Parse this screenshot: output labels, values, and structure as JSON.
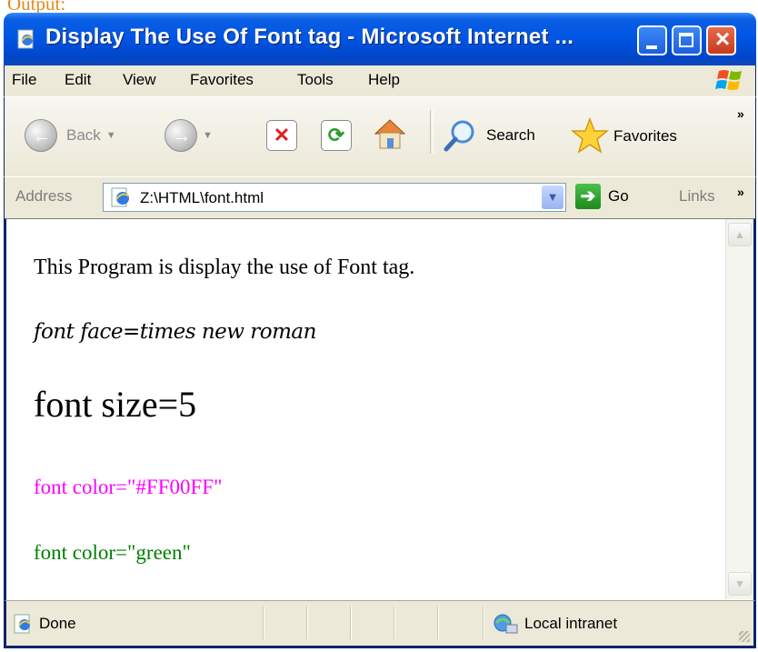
{
  "cropped_header": "Output:",
  "window": {
    "title": "Display The Use Of Font tag - Microsoft Internet ..."
  },
  "menu": {
    "items": [
      "File",
      "Edit",
      "View",
      "Favorites",
      "Tools",
      "Help"
    ]
  },
  "toolbar": {
    "back_label": "Back",
    "search_label": "Search",
    "favorites_label": "Favorites",
    "overflow": "»"
  },
  "address": {
    "label": "Address",
    "value": "Z:\\HTML\\font.html",
    "go_label": "Go",
    "links_label": "Links",
    "overflow": "»"
  },
  "content": {
    "line1": "This Program is display the use of Font tag.",
    "line2": "font face=times new roman",
    "line3": "font size=5",
    "line4": "font color=\"#FF00FF\"",
    "line5": "font color=\"green\"",
    "colors": {
      "magenta": "#FF00FF",
      "green": "#008000"
    }
  },
  "status": {
    "text": "Done",
    "zone": "Local intranet"
  }
}
